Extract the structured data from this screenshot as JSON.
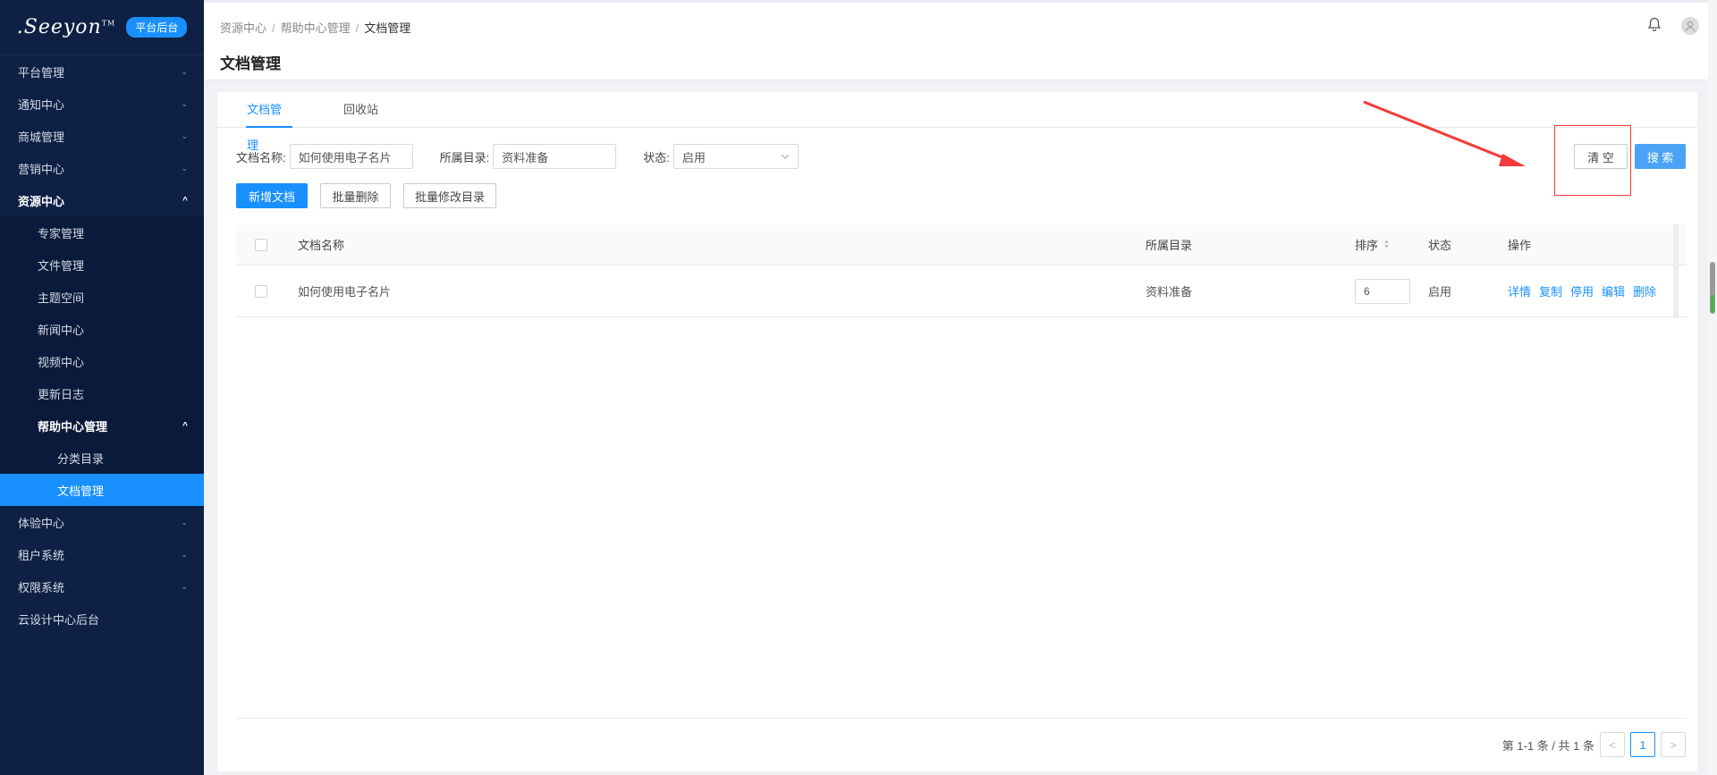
{
  "brand": {
    "logo_text": ".Seeyon",
    "logo_tm": "TM",
    "badge": "平台后台"
  },
  "sidebar": {
    "items": [
      {
        "label": "平台管理"
      },
      {
        "label": "通知中心"
      },
      {
        "label": "商城管理"
      },
      {
        "label": "营销中心"
      },
      {
        "label": "资源中心"
      },
      {
        "label": "专家管理"
      },
      {
        "label": "文件管理"
      },
      {
        "label": "主题空间"
      },
      {
        "label": "新闻中心"
      },
      {
        "label": "视频中心"
      },
      {
        "label": "更新日志"
      },
      {
        "label": "帮助中心管理"
      },
      {
        "label": "分类目录"
      },
      {
        "label": "文档管理"
      },
      {
        "label": "体验中心"
      },
      {
        "label": "租户系统"
      },
      {
        "label": "权限系统"
      },
      {
        "label": "云设计中心后台"
      }
    ],
    "chevron_down": "⌄",
    "chevron_up": "^"
  },
  "header": {
    "breadcrumb": [
      "资源中心",
      "帮助中心管理",
      "文档管理"
    ],
    "separator": "/",
    "title": "文档管理"
  },
  "tabs": [
    {
      "label": "文档管理"
    },
    {
      "label": "回收站"
    }
  ],
  "filters": {
    "name_label": "文档名称:",
    "name_value": "如何使用电子名片",
    "dir_label": "所属目录:",
    "dir_value": "资料准备",
    "status_label": "状态:",
    "status_value": "启用",
    "clear": "清 空",
    "search": "搜 索"
  },
  "actions": {
    "add": "新增文档",
    "batch_delete": "批量删除",
    "batch_move": "批量修改目录"
  },
  "table": {
    "columns": {
      "name": "文档名称",
      "dir": "所属目录",
      "sort": "排序",
      "status": "状态",
      "ops": "操作"
    },
    "rows": [
      {
        "name": "如何使用电子名片",
        "dir": "资料准备",
        "sort": "6",
        "status": "启用",
        "ops": [
          "详情",
          "复制",
          "停用",
          "编辑",
          "删除"
        ]
      }
    ]
  },
  "pagination": {
    "summary": "第 1-1 条 / 共 1 条",
    "current": "1",
    "prev": "<",
    "next": ">"
  },
  "colors": {
    "sidebar_bg": "#0e2044",
    "primary": "#1890ff",
    "annotation": "#f43a3a"
  }
}
